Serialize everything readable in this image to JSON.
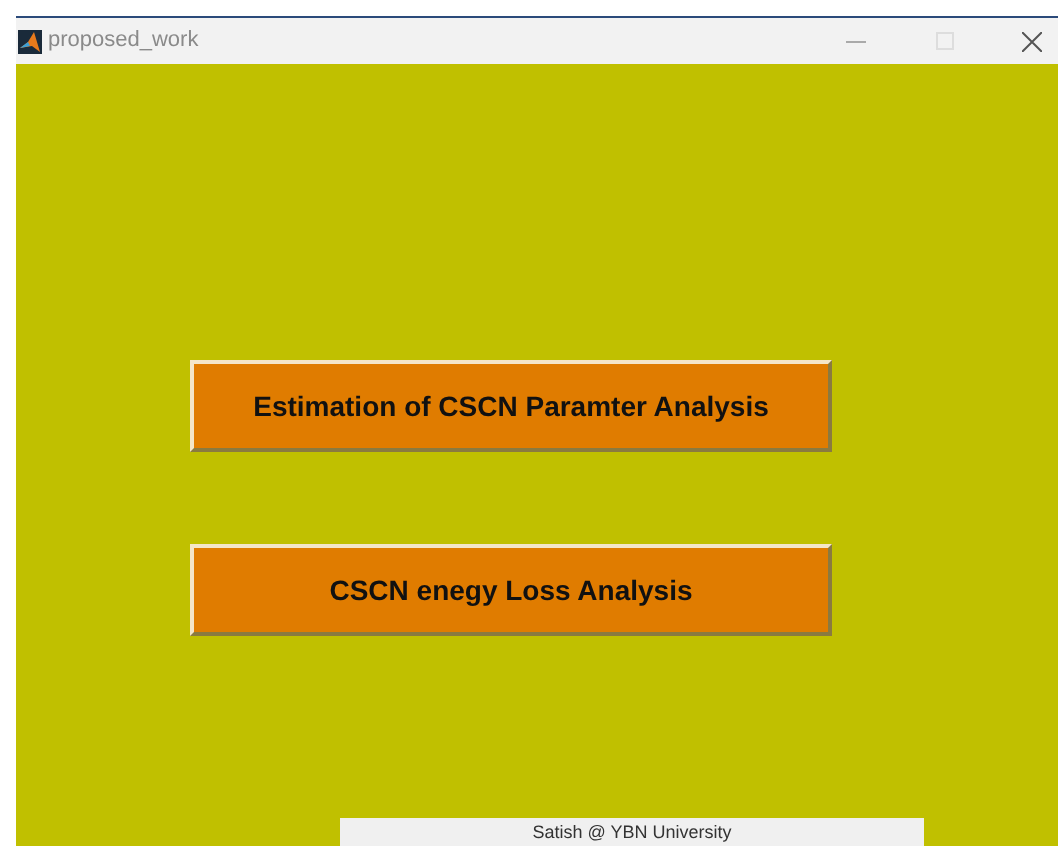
{
  "window": {
    "title": "proposed_work"
  },
  "buttons": [
    {
      "label": "Estimation of CSCN Paramter Analysis"
    },
    {
      "label": "CSCN enegy Loss Analysis"
    }
  ],
  "footer": {
    "text": "Satish @ YBN University"
  }
}
